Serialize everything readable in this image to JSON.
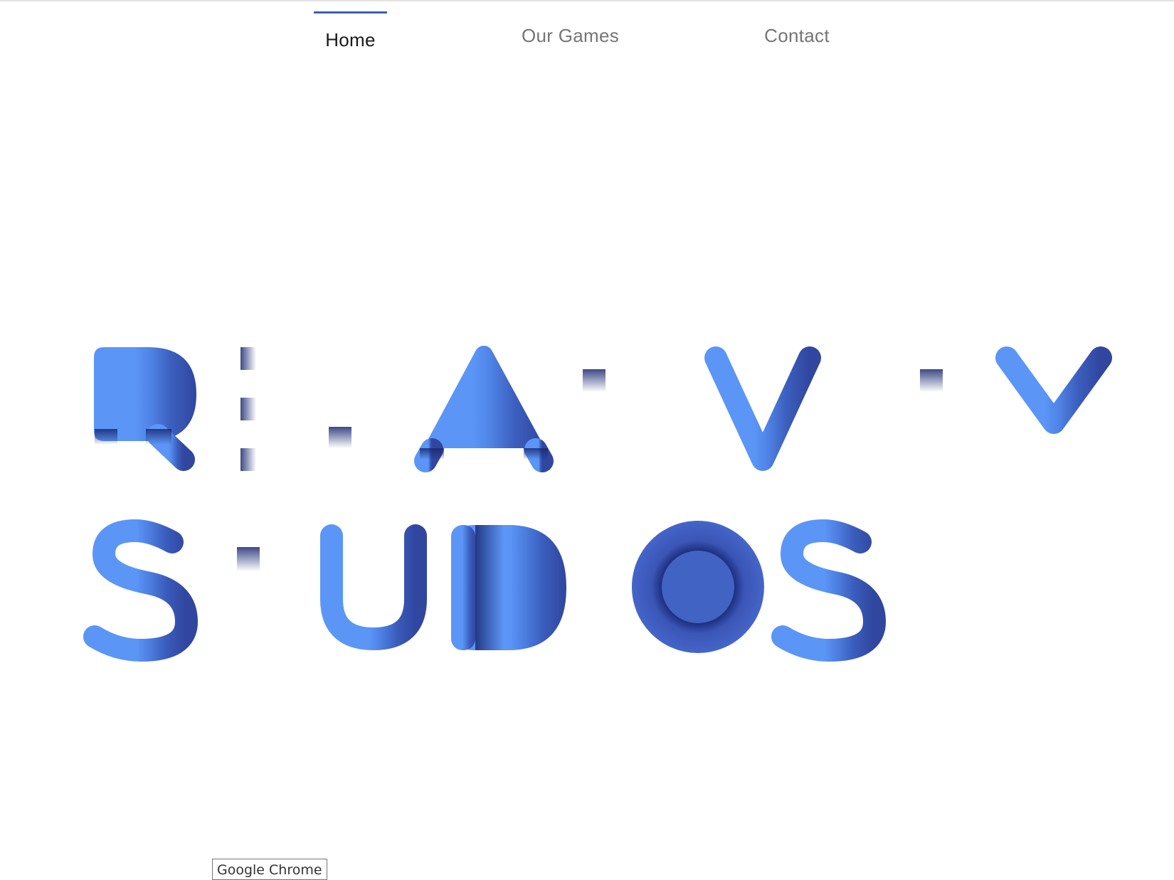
{
  "nav": {
    "home_label": "Home",
    "games_label": "Our Games",
    "contact_label": "Contact",
    "active": "Home"
  },
  "logo": {
    "line1": "RELATIVITY",
    "line2": "STUDIOS"
  },
  "tooltip": {
    "text": "Google Chrome"
  },
  "colors": {
    "accent": "#3f5fb3",
    "logo_light": "#5b96f7",
    "logo_mid": "#4a78db",
    "logo_dark": "#33489e",
    "logo_shadow": "#1f2d75",
    "nav_text": "#757575",
    "nav_active_text": "#1a1a1a"
  }
}
